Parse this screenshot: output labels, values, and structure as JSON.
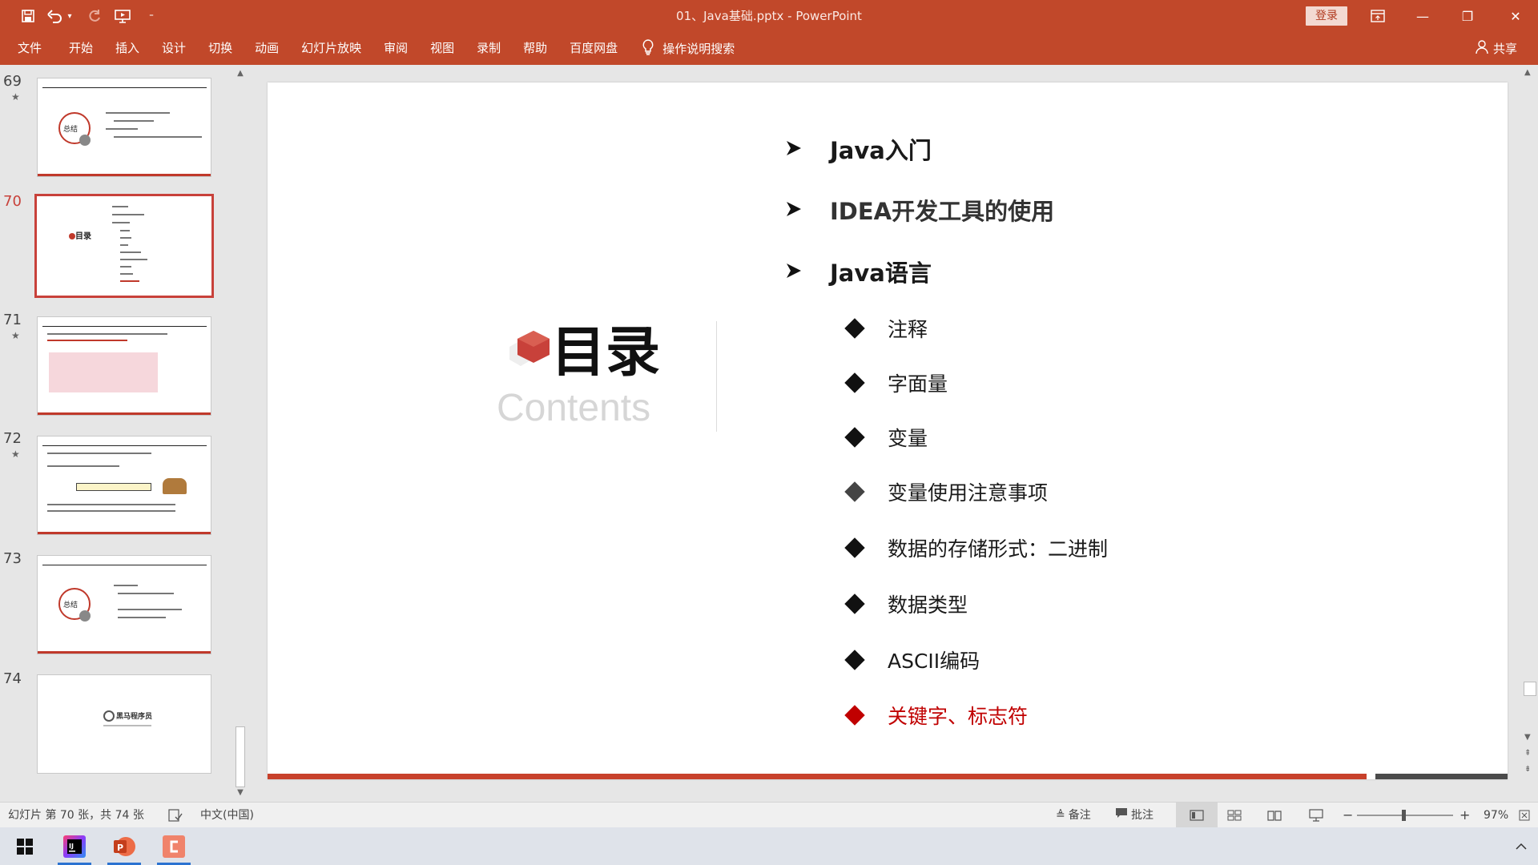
{
  "window": {
    "title": "01、Java基础.pptx - PowerPoint",
    "login_label": "登录",
    "minimize": "—",
    "restore": "❐",
    "close": "✕"
  },
  "quick_access": {
    "save_icon": "save-icon",
    "undo_icon": "undo-icon",
    "redo_icon": "redo-icon",
    "present_icon": "slideshow-icon",
    "customize_icon": "customize-icon"
  },
  "ribbon": {
    "tabs": [
      "文件",
      "开始",
      "插入",
      "设计",
      "切换",
      "动画",
      "幻灯片放映",
      "审阅",
      "视图",
      "录制",
      "帮助",
      "百度网盘"
    ],
    "tell_me": "操作说明搜索",
    "share": "共享"
  },
  "thumbnails": [
    {
      "num": "69",
      "star": "★",
      "label": "总结"
    },
    {
      "num": "70",
      "star": "",
      "label": "目录"
    },
    {
      "num": "71",
      "star": "★",
      "label": ""
    },
    {
      "num": "72",
      "star": "★",
      "label": ""
    },
    {
      "num": "73",
      "star": "",
      "label": "总结"
    },
    {
      "num": "74",
      "star": "",
      "label": "黑马程序员"
    }
  ],
  "slide": {
    "title": "目录",
    "subtitle": "Contents",
    "items_level1": [
      "Java入门",
      "IDEA开发工具的使用",
      "Java语言"
    ],
    "items_level2": [
      "注释",
      "字面量",
      "变量",
      "变量使用注意事项",
      "数据的存储形式：二进制",
      "数据类型",
      "ASCII编码",
      "关键字、标志符"
    ]
  },
  "status": {
    "slide_info": "幻灯片 第 70 张，共 74 张",
    "language": "中文(中国)",
    "notes": "备注",
    "comments": "批注",
    "zoom_minus": "−",
    "zoom_plus": "+",
    "zoom": "97%"
  },
  "colors": {
    "accent": "#c1482a",
    "red_text": "#c00000"
  }
}
